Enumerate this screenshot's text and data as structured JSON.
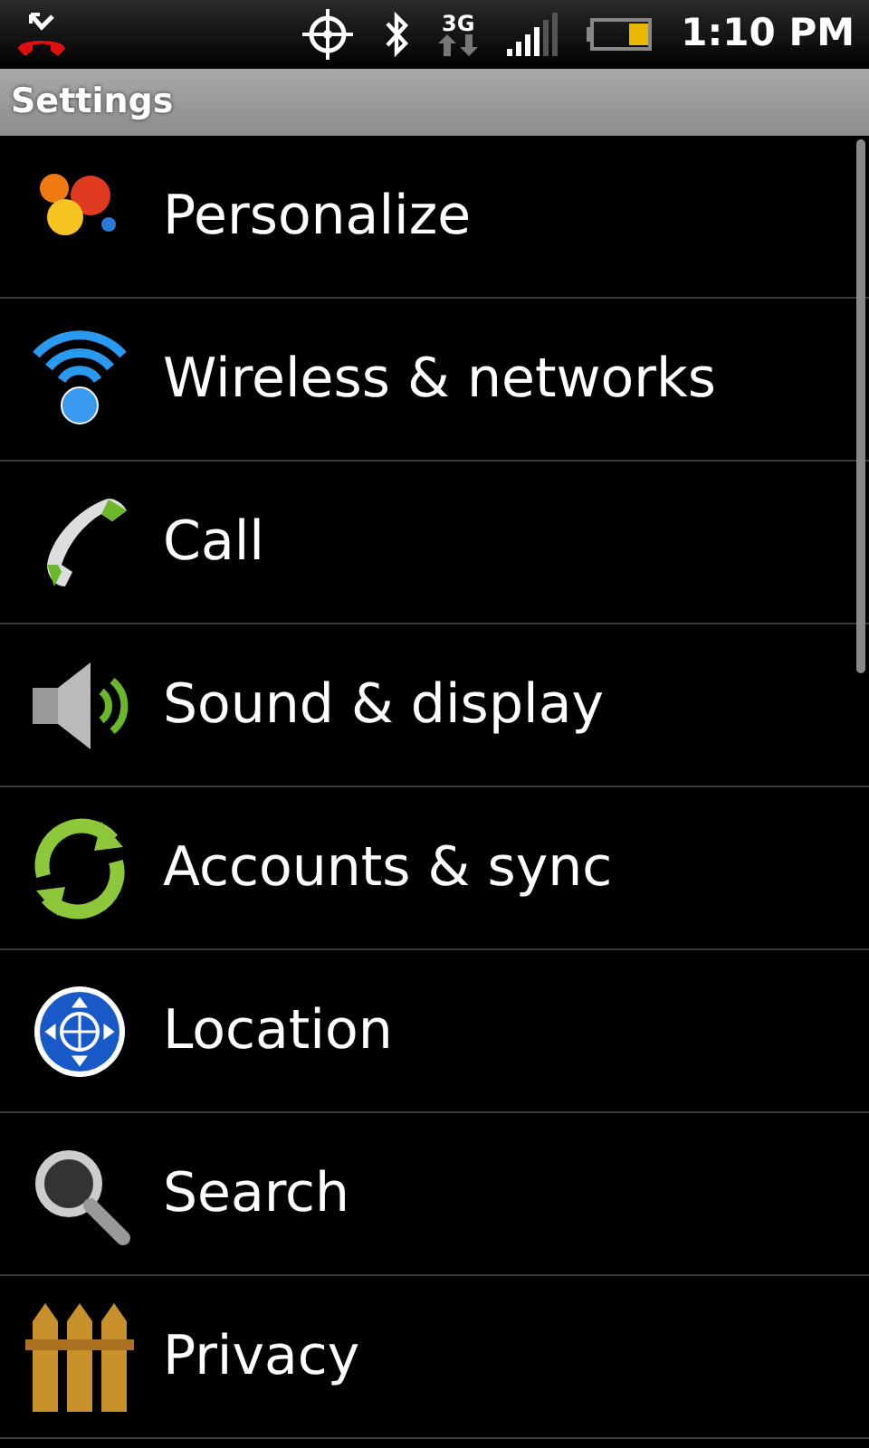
{
  "status_bar": {
    "network": "3G",
    "time": "1:10 PM",
    "battery": {
      "level": 0.35
    }
  },
  "title": "Settings",
  "items": [
    {
      "label": "Personalize",
      "kind": "paint"
    },
    {
      "label": "Wireless & networks",
      "kind": "wireless"
    },
    {
      "label": "Call",
      "kind": "call"
    },
    {
      "label": "Sound & display",
      "kind": "sound"
    },
    {
      "label": "Accounts & sync",
      "kind": "sync"
    },
    {
      "label": "Location",
      "kind": "location"
    },
    {
      "label": "Search",
      "kind": "search"
    },
    {
      "label": "Privacy",
      "kind": "privacy"
    }
  ]
}
